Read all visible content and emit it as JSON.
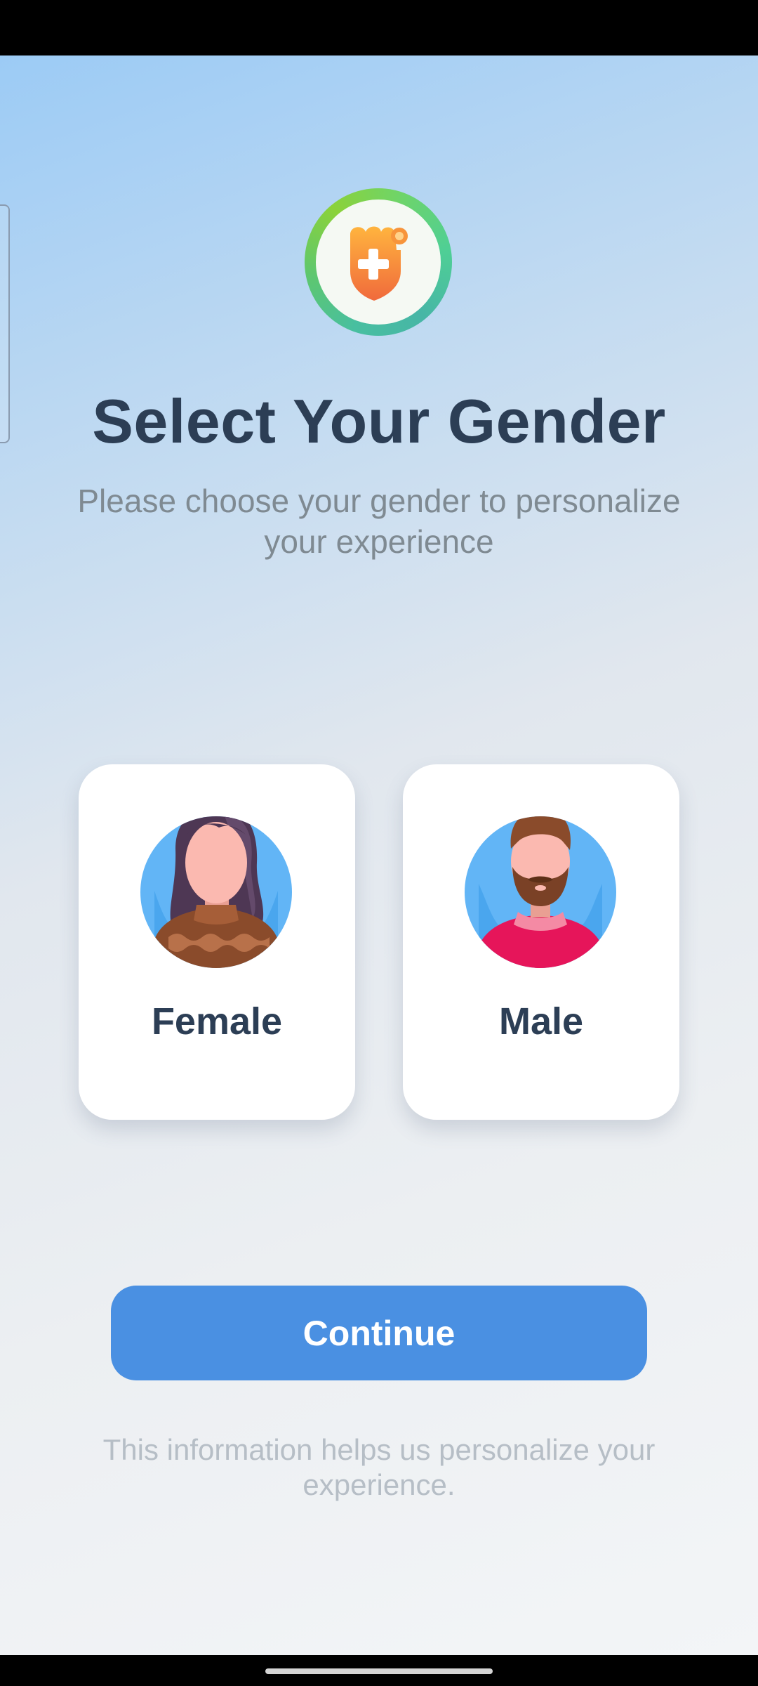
{
  "app_logo": {
    "icon": "health-shield-heart-icon",
    "ring_colors": [
      "#8bd23a",
      "#48bfa0"
    ],
    "shield_color": "#f7943b"
  },
  "header": {
    "title": "Select Your Gender",
    "subtitle": "Please choose your gender to personalize your experience"
  },
  "options": [
    {
      "label": "Female",
      "icon": "female-avatar-icon"
    },
    {
      "label": "Male",
      "icon": "male-avatar-icon"
    }
  ],
  "continue_button": {
    "label": "Continue",
    "color": "#4a90e2"
  },
  "footnote": "This information helps us personalize your experience.",
  "colors": {
    "title": "#2c3e55",
    "subtitle": "#7f8a92",
    "footnote": "#b6bec6"
  }
}
